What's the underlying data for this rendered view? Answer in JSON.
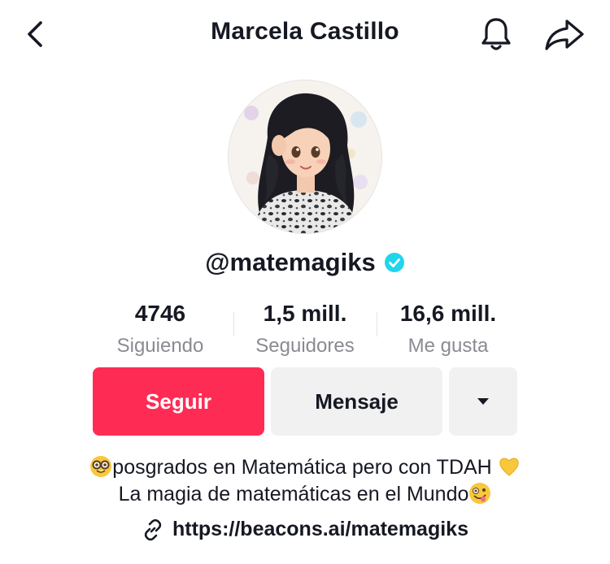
{
  "header": {
    "title": "Marcela Castillo",
    "icons": [
      "back-icon",
      "bell-icon",
      "share-icon"
    ]
  },
  "profile": {
    "username": "@matemagiks",
    "verified": true,
    "verified_color": "#20d5ec"
  },
  "stats": [
    {
      "value": "4746",
      "label": "Siguiendo"
    },
    {
      "value": "1,5 mill.",
      "label": "Seguidores"
    },
    {
      "value": "16,6 mill.",
      "label": "Me gusta"
    }
  ],
  "actions": {
    "follow_label": "Seguir",
    "message_label": "Mensaje",
    "more_icon": "caret-down-icon",
    "follow_color": "#fe2c55"
  },
  "bio": {
    "line1_emoji": "nerd-face",
    "line1_text": "posgrados en Matemática pero con TDAH",
    "line1_emoji_end": "yellow-heart",
    "line2_text": "La magia de matemáticas en el Mundo",
    "line2_emoji_end": "zany-face"
  },
  "link": {
    "icon": "link-icon",
    "text": "https://beacons.ai/matemagiks"
  }
}
